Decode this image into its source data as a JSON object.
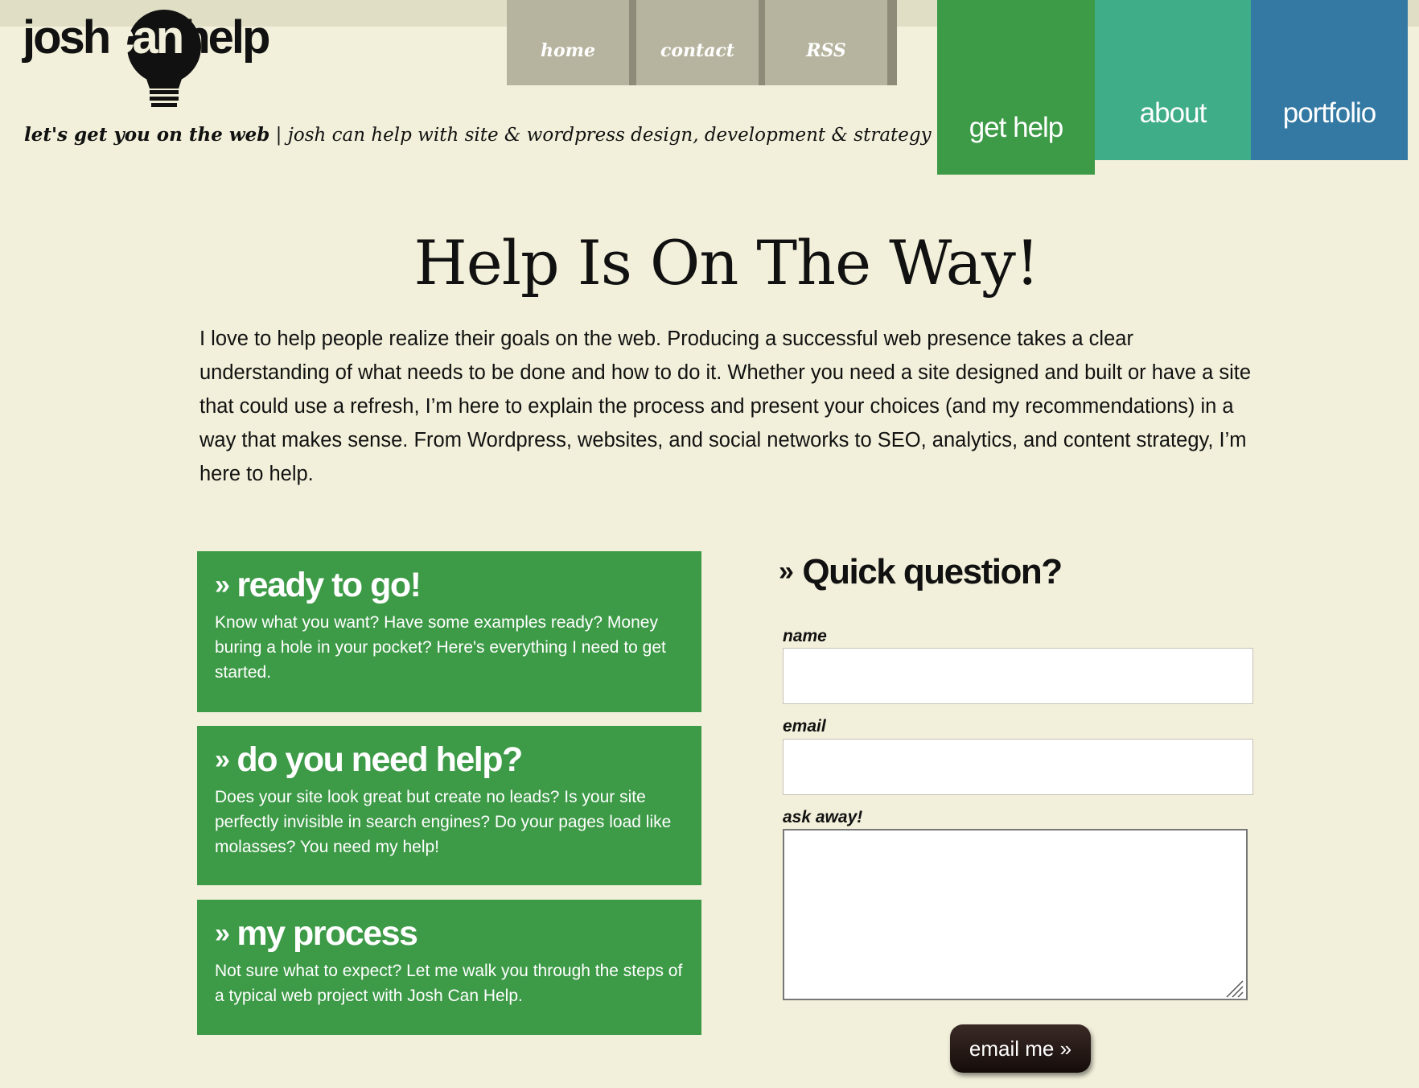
{
  "logo": {
    "part1": "josh",
    "part2": "can",
    "part3": "help"
  },
  "tagline": {
    "bold": "let's get you on the web",
    "rest": " | josh can help with site & wordpress design, development & strategy"
  },
  "tabs": [
    {
      "label": "home"
    },
    {
      "label": "contact"
    },
    {
      "label": "RSS"
    }
  ],
  "main_nav": [
    {
      "label": "get help",
      "color": "#3d9a47",
      "active": true
    },
    {
      "label": "about",
      "color": "#3fad87"
    },
    {
      "label": "portfolio",
      "color": "#3479a3"
    }
  ],
  "page": {
    "title": "Help Is On The Way!",
    "intro": "I love to help people realize their goals on the web. Producing a successful web presence takes a clear understanding of what needs to be done and how to do it. Whether you need a site designed and built or have a site that could use a refresh, I’m here to explain the process and present your choices (and my recommendations) in a way that makes sense. From Wordpress, websites, and social networks to SEO, analytics, and content strategy, I’m here to help."
  },
  "boxes": [
    {
      "title": "ready to go!",
      "desc": "Know what you want? Have some examples ready? Money buring a hole in your pocket? Here's everything I need to get started."
    },
    {
      "title": "do you need help?",
      "desc": "Does your site look great but create no leads? Is your site perfectly invisible in search engines? Do your pages load like molasses? You need my help!"
    },
    {
      "title": "my process",
      "desc": "Not sure what to expect? Let me walk you through the steps of a typical web project with Josh Can Help."
    }
  ],
  "raquo": "»",
  "form": {
    "title": "Quick question?",
    "name_label": "name",
    "name_value": "",
    "email_label": "email",
    "email_value": "",
    "ask_label": "ask away!",
    "ask_value": "",
    "submit_label": "email me »"
  },
  "colors": {
    "background": "#f2f0da",
    "green": "#3d9a47",
    "teal": "#3fad87",
    "blue": "#3479a3",
    "tab_gray": "#b6b49f"
  }
}
